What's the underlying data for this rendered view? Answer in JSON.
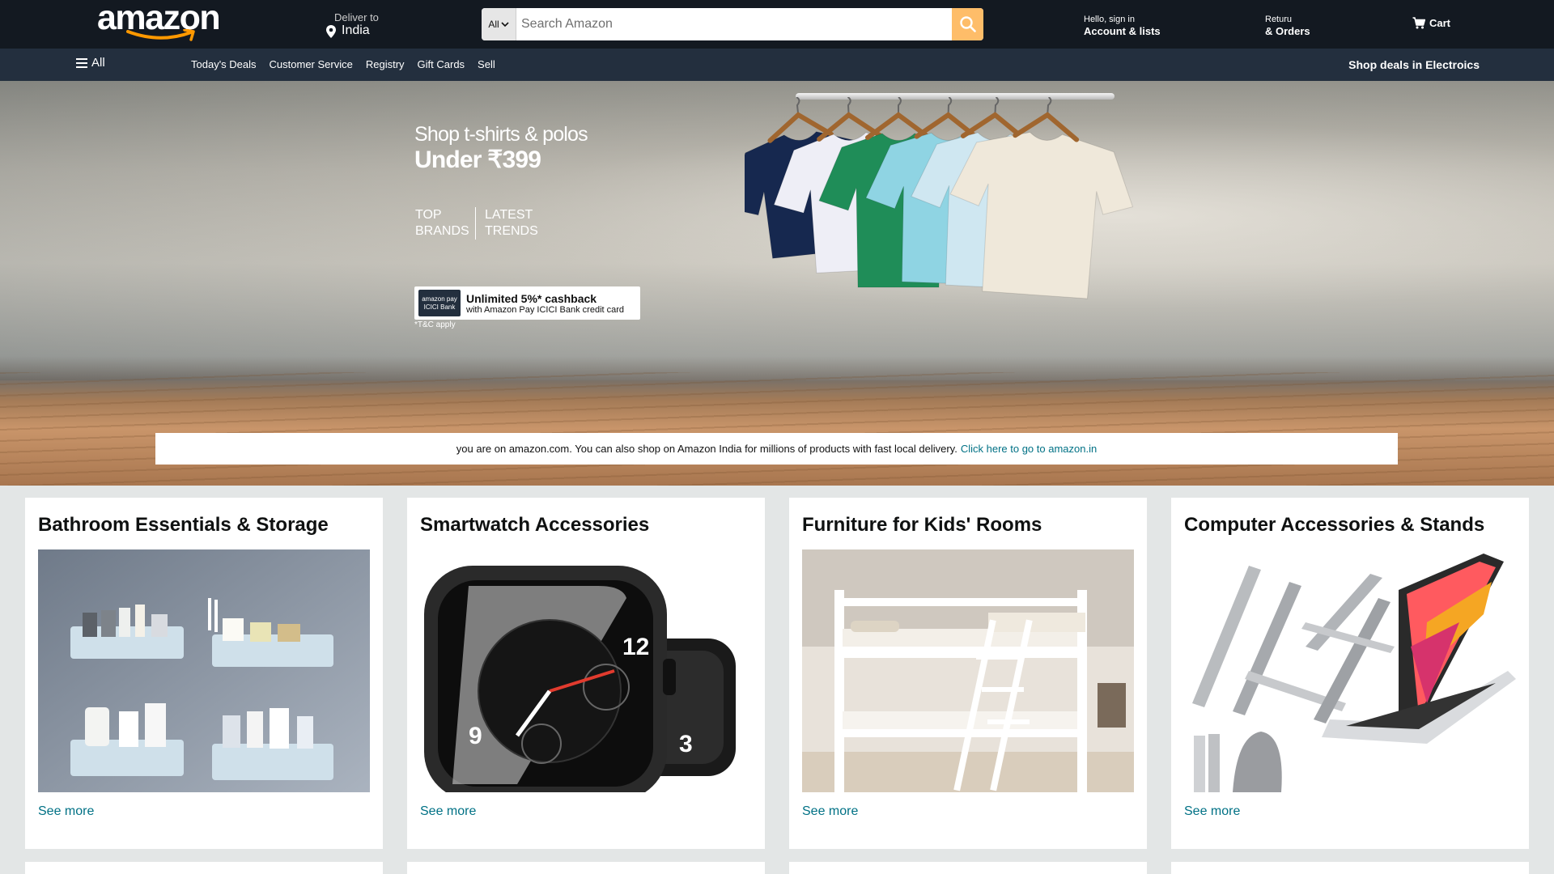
{
  "header": {
    "logo_text": "amazon",
    "deliver_label": "Deliver to",
    "deliver_value": "India",
    "search": {
      "category": "All",
      "placeholder": "Search Amazon"
    },
    "account": {
      "greeting": "Hello, sign in",
      "label": "Account & lists"
    },
    "orders": {
      "line1": "Returu",
      "line2": "& Orders"
    },
    "cart_label": "Cart"
  },
  "subnav": {
    "all_label": "All",
    "links": [
      "Today's Deals",
      "Customer Service",
      "Registry",
      "Gift Cards",
      "Sell"
    ],
    "promo": "Shop deals in Electroics"
  },
  "hero": {
    "title": "Shop t-shirts & polos",
    "price": "Under ₹399",
    "tags": [
      {
        "line1": "TOP",
        "line2": "BRANDS"
      },
      {
        "line1": "LATEST",
        "line2": "TRENDS"
      }
    ],
    "cashback": {
      "logo_line1": "amazon pay",
      "logo_line2": "ICICI Bank",
      "main": "Unlimited 5%* cashback",
      "sub": "with Amazon Pay ICICI Bank credit card"
    },
    "tc": "*T&C apply",
    "shirt_colors": [
      "#16284f",
      "#eeeef6",
      "#1f8d58",
      "#8fd4e3",
      "#cfe7f1",
      "#efe8da"
    ]
  },
  "notice": {
    "text": "you are on amazon.com. You can also shop on Amazon India for millions of products with fast local delivery.",
    "link": "Click here to go to amazon.in"
  },
  "cards": [
    {
      "title": "Bathroom Essentials & Storage",
      "link": "See more"
    },
    {
      "title": "Smartwatch Accessories",
      "link": "See more"
    },
    {
      "title": "Furniture for Kids' Rooms",
      "link": "See more"
    },
    {
      "title": "Computer Accessories & Stands",
      "link": "See more"
    }
  ],
  "colors": {
    "nav_dark": "#131921",
    "nav_secondary": "#232f3e",
    "search_button": "#febd69",
    "link": "#007185",
    "page_bg": "#e3e6e6"
  }
}
